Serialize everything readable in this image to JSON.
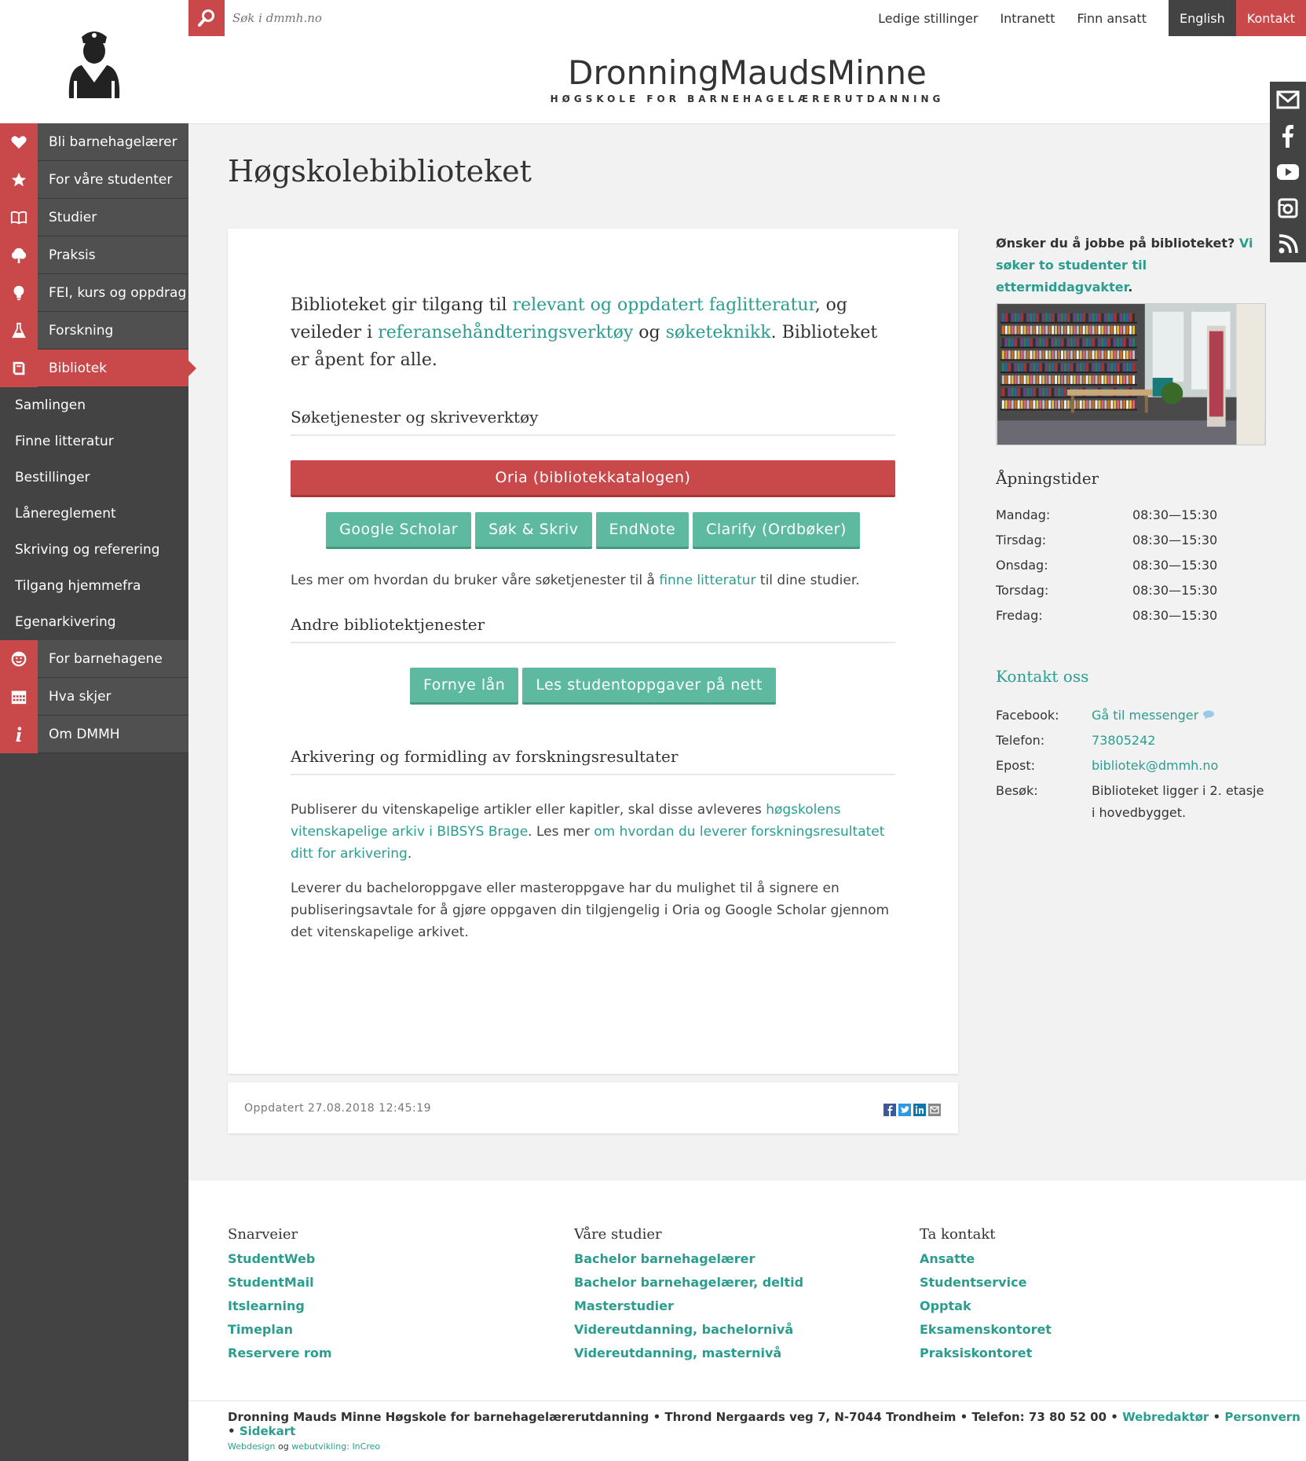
{
  "search": {
    "placeholder": "Søk i dmmh.no"
  },
  "top_links": [
    "Ledige stillinger",
    "Intranett",
    "Finn ansatt",
    "English",
    "Kontakt"
  ],
  "brand": {
    "name": "DronningMaudsMinne",
    "tagline": "HØGSKOLE FOR BARNEHAGELÆRERUTDANNING"
  },
  "nav": {
    "items": [
      {
        "label": "Bli barnehagelærer",
        "icon": "heart-icon"
      },
      {
        "label": "For våre studenter",
        "icon": "star-icon"
      },
      {
        "label": "Studier",
        "icon": "book-icon"
      },
      {
        "label": "Praksis",
        "icon": "tree-icon"
      },
      {
        "label": "FEI, kurs og oppdrag",
        "icon": "lightbulb-icon"
      },
      {
        "label": "Forskning",
        "icon": "flask-icon"
      },
      {
        "label": "Bibliotek",
        "icon": "library-book-icon",
        "active": true
      }
    ],
    "sub_items": [
      "Samlingen",
      "Finne litteratur",
      "Bestillinger",
      "Lånereglement",
      "Skriving og referering",
      "Tilgang hjemmefra",
      "Egenarkivering"
    ],
    "items_after": [
      {
        "label": "For barnehagene",
        "icon": "child-face-icon"
      },
      {
        "label": "Hva skjer",
        "icon": "calendar-icon"
      },
      {
        "label": "Om DMMH",
        "icon": "info-icon"
      }
    ]
  },
  "page": {
    "title": "Høgskolebiblioteket"
  },
  "intro": {
    "t1": "Biblioteket gir tilgang til ",
    "l1": "relevant og oppdatert faglitteratur",
    "t2": ", og veileder i ",
    "l2": "referansehåndteringsverktøy",
    "t3": " og ",
    "l3": "søketeknikk",
    "t4": ". Biblioteket er åpent for alle."
  },
  "sections": {
    "search_tools": "Søketjenester og skriveverktøy",
    "other_services": "Andre bibliotektjenester",
    "archiving": "Arkivering og formidling av forskningsresultater"
  },
  "buttons": {
    "oria": "Oria (bibliotekkatalogen)",
    "scholar": "Google Scholar",
    "sok_skriv": "Søk & Skriv",
    "endnote": "EndNote",
    "clarify": "Clarify (Ordbøker)",
    "renew": "Fornye lån",
    "theses": "Les studentoppgaver på nett"
  },
  "read_more": {
    "t1": "Les mer om hvordan du bruker våre søketjenester til å ",
    "link": "finne litteratur",
    "t2": " til dine studier."
  },
  "archive_p1": {
    "t1": "Publiserer du vitenskapelige artikler eller kapitler, skal disse avleveres ",
    "l1": "høgskolens vitenskapelige arkiv i BIBSYS Brage",
    "t2": ". Les mer ",
    "l2": "om hvordan du leverer forskningsresultatet ditt for arkivering",
    "t3": "."
  },
  "archive_p2": "Leverer du bacheloroppgave eller masteroppgave har du mulighet til å signere en publiseringsavtale for å gjøre oppgaven din tilgjengelig i Oria og Google Scholar gjennom det vitenskapelige arkivet.",
  "meta": {
    "updated": "Oppdatert 27.08.2018 12:45:19"
  },
  "job": {
    "text": "Ønsker du å jobbe på biblioteket? ",
    "link": "Vi søker to studenter til ettermiddagvakter",
    "end": "."
  },
  "hours": {
    "title": "Åpningstider",
    "rows": [
      {
        "day": "Mandag:",
        "time": "08:30—15:30"
      },
      {
        "day": "Tirsdag:",
        "time": "08:30—15:30"
      },
      {
        "day": "Onsdag:",
        "time": "08:30—15:30"
      },
      {
        "day": "Torsdag:",
        "time": "08:30—15:30"
      },
      {
        "day": "Fredag:",
        "time": "08:30—15:30"
      }
    ]
  },
  "contact": {
    "title": "Kontakt oss",
    "facebook_label": "Facebook:",
    "facebook_value": "Gå til messenger",
    "phone_label": "Telefon:",
    "phone_value": "73805242",
    "email_label": "Epost:",
    "email_value": "bibliotek@dmmh.no",
    "visit_label": "Besøk:",
    "visit_value": "Biblioteket ligger i 2. etasje i hovedbygget."
  },
  "footer": {
    "col1": {
      "title": "Snarveier",
      "links": [
        "StudentWeb",
        "StudentMail",
        "Itslearning",
        "Timeplan",
        "Reservere rom"
      ]
    },
    "col2": {
      "title": "Våre studier",
      "links": [
        "Bachelor barnehagelærer",
        "Bachelor barnehagelærer, deltid",
        "Masterstudier",
        "Videreutdanning, bachelornivå",
        "Videreutdanning, masternivå"
      ]
    },
    "col3": {
      "title": "Ta kontakt",
      "links": [
        "Ansatte",
        "Studentservice",
        "Opptak",
        "Eksamenskontoret",
        "Praksiskontoret"
      ]
    },
    "address": "Dronning Mauds Minne Høgskole for barnehagelærerutdanning • Throndl Nergaards veg 7, N-7044 Trondheim • Telefon: 73 80 52 00 • ",
    "webredaktor": "Webredaktør",
    "personvern": "Personvern",
    "sidekart": "Sidekart",
    "sep": " • ",
    "credit_webdesign": "Webdesign",
    "credit_og": " og ",
    "credit_dev": "webutvikling: InCreo"
  },
  "colors": {
    "accent_red": "#c9484a",
    "teal": "#5eb9a1",
    "link": "#2a9d8f",
    "sidebar": "#434343"
  }
}
